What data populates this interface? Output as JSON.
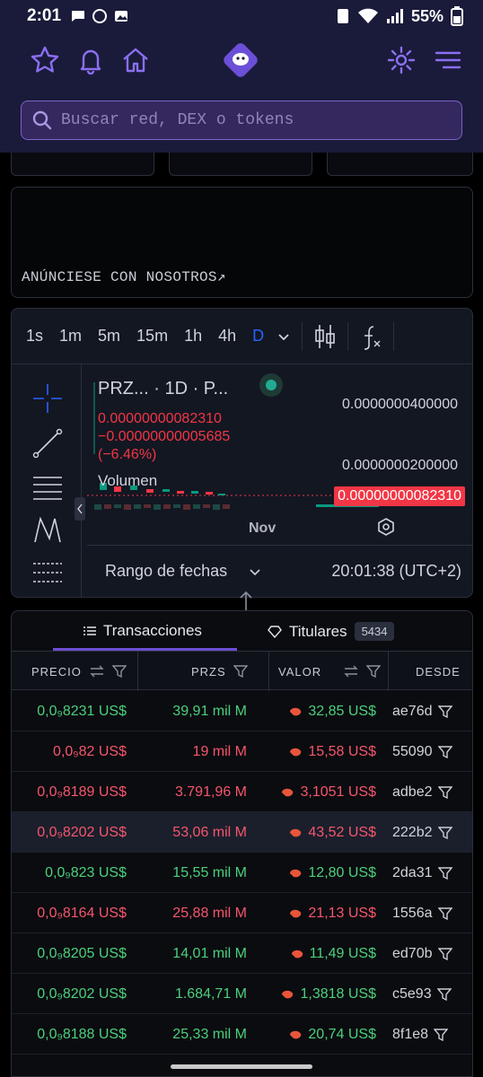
{
  "status_bar": {
    "time": "2:01",
    "battery": "55%"
  },
  "search": {
    "placeholder": "Buscar red, DEX o tokens"
  },
  "ad": {
    "label": "ANÚNCIESE CON NOSOTROS↗"
  },
  "chart": {
    "timeframes": [
      "1s",
      "1m",
      "5m",
      "15m",
      "1h",
      "4h",
      "D"
    ],
    "active_timeframe": "D",
    "legend_title": "PRZ...  · 1D · P...",
    "legend_price": "0.00000000082310",
    "legend_change": "−0.00000000005685",
    "legend_pct": "(−6.46%)",
    "volume_label": "Volumen",
    "y_labels": [
      "0.0000000400000",
      "0.0000000200000"
    ],
    "last_price": "0.00000000082310",
    "x_label": "Nov",
    "range_label": "Rango de fechas",
    "clock": "20:01:38 (UTC+2)",
    "colors": {
      "down": "#f23645",
      "up": "#089981",
      "accent": "#2962ff"
    }
  },
  "trades": {
    "tab_transactions": "Transacciones",
    "tab_holders": "Titulares",
    "holders_count": "5434",
    "headers": {
      "price": "PRECIO",
      "amount": "PRZS",
      "value": "VALOR",
      "from": "DESDE"
    },
    "rows": [
      {
        "side": "buy",
        "price": "0,0₉8231 US$",
        "amount": "39,91 mil M",
        "value": "32,85 US$",
        "from": "ae76d"
      },
      {
        "side": "sell",
        "price": "0,0₉82 US$",
        "amount": "19 mil M",
        "value": "15,58 US$",
        "from": "55090"
      },
      {
        "side": "sell",
        "price": "0,0₉8189 US$",
        "amount": "3.791,96 M",
        "value": "3,1051 US$",
        "from": "adbe2"
      },
      {
        "side": "sell",
        "price": "0,0₉8202 US$",
        "amount": "53,06 mil M",
        "value": "43,52 US$",
        "from": "222b2"
      },
      {
        "side": "buy",
        "price": "0,0₉823 US$",
        "amount": "15,55 mil M",
        "value": "12,80 US$",
        "from": "2da31"
      },
      {
        "side": "sell",
        "price": "0,0₉8164 US$",
        "amount": "25,88 mil M",
        "value": "21,13 US$",
        "from": "1556a"
      },
      {
        "side": "buy",
        "price": "0,0₉8205 US$",
        "amount": "14,01 mil M",
        "value": "11,49 US$",
        "from": "ed70b"
      },
      {
        "side": "buy",
        "price": "0,0₉8202 US$",
        "amount": "1.684,71 M",
        "value": "1,3818 US$",
        "from": "c5e93"
      },
      {
        "side": "buy",
        "price": "0,0₉8188 US$",
        "amount": "25,33 mil M",
        "value": "20,74 US$",
        "from": "8f1e8"
      }
    ]
  }
}
